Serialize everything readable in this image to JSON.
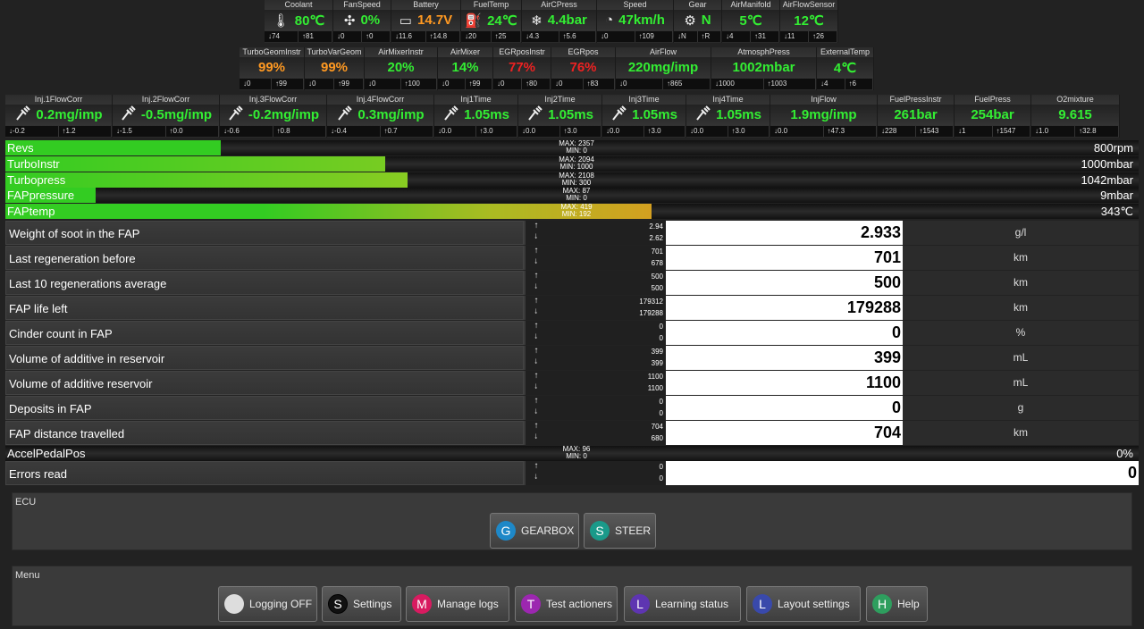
{
  "row1": [
    {
      "label": "Coolant",
      "value": "80℃",
      "color": "green",
      "icon": "🌡",
      "min": "↓74",
      "max": "↑81"
    },
    {
      "label": "FanSpeed",
      "value": "0%",
      "color": "green",
      "icon": "✣",
      "min": "↓0",
      "max": "↑0"
    },
    {
      "label": "Battery",
      "value": "14.7V",
      "color": "orange",
      "icon": "▭",
      "min": "↓11.6",
      "max": "↑14.8"
    },
    {
      "label": "FuelTemp",
      "value": "24℃",
      "color": "green",
      "icon": "⛽",
      "min": "↓20",
      "max": "↑25"
    },
    {
      "label": "AirCPress",
      "value": "4.4bar",
      "color": "green",
      "icon": "❄",
      "min": "↓4.3",
      "max": "↑5.6"
    },
    {
      "label": "Speed",
      "value": "47km/h",
      "color": "green",
      "icon": "◔",
      "min": "↓0",
      "max": "↑109"
    },
    {
      "label": "Gear",
      "value": "N",
      "color": "green",
      "icon": "⚙",
      "min": "↓N",
      "max": "↑R"
    },
    {
      "label": "AirManifold",
      "value": "5℃",
      "color": "green",
      "icon": "",
      "min": "↓4",
      "max": "↑31"
    },
    {
      "label": "AirFlowSensor",
      "value": "12℃",
      "color": "green",
      "icon": "",
      "min": "↓11",
      "max": "↑26"
    }
  ],
  "row2": [
    {
      "label": "TurboGeomInstr",
      "value": "99%",
      "color": "orange",
      "min": "↓0",
      "max": "↑99"
    },
    {
      "label": "TurboVarGeom",
      "value": "99%",
      "color": "orange",
      "min": "↓0",
      "max": "↑99"
    },
    {
      "label": "AirMixerInstr",
      "value": "20%",
      "color": "green",
      "min": "↓0",
      "max": "↑100"
    },
    {
      "label": "AirMixer",
      "value": "14%",
      "color": "green",
      "min": "↓0",
      "max": "↑99"
    },
    {
      "label": "EGRposInstr",
      "value": "77%",
      "color": "red",
      "min": "↓0",
      "max": "↑80"
    },
    {
      "label": "EGRpos",
      "value": "76%",
      "color": "red",
      "min": "↓0",
      "max": "↑83"
    },
    {
      "label": "AirFlow",
      "value": "220mg/imp",
      "color": "green",
      "min": "↓0",
      "max": "↑865"
    },
    {
      "label": "AtmosphPress",
      "value": "1002mbar",
      "color": "green",
      "min": "↓1000",
      "max": "↑1003"
    },
    {
      "label": "ExternalTemp",
      "value": "4℃",
      "color": "green",
      "min": "↓4",
      "max": "↑6"
    }
  ],
  "row3": [
    {
      "label": "Inj.1FlowCorr",
      "value": "0.2mg/imp",
      "color": "green",
      "icon": "injector",
      "min": "↓-0.2",
      "max": "↑1.2"
    },
    {
      "label": "Inj.2FlowCorr",
      "value": "-0.5mg/imp",
      "color": "green",
      "icon": "injector",
      "min": "↓-1.5",
      "max": "↑0.0"
    },
    {
      "label": "Inj.3FlowCorr",
      "value": "-0.2mg/imp",
      "color": "green",
      "icon": "injector",
      "min": "↓-0.6",
      "max": "↑0.8"
    },
    {
      "label": "Inj.4FlowCorr",
      "value": "0.3mg/imp",
      "color": "green",
      "icon": "injector",
      "min": "↓-0.4",
      "max": "↑0.7"
    },
    {
      "label": "Inj1Time",
      "value": "1.05ms",
      "color": "green",
      "icon": "injector",
      "min": "↓0.0",
      "max": "↑3.0"
    },
    {
      "label": "Inj2Time",
      "value": "1.05ms",
      "color": "green",
      "icon": "injector",
      "min": "↓0.0",
      "max": "↑3.0"
    },
    {
      "label": "Inj3Time",
      "value": "1.05ms",
      "color": "green",
      "icon": "injector",
      "min": "↓0.0",
      "max": "↑3.0"
    },
    {
      "label": "Inj4Time",
      "value": "1.05ms",
      "color": "green",
      "icon": "injector",
      "min": "↓0.0",
      "max": "↑3.0"
    },
    {
      "label": "InjFlow",
      "value": "1.9mg/imp",
      "color": "green",
      "icon": "",
      "min": "↓0.0",
      "max": "↑47.3"
    },
    {
      "label": "FuelPressInstr",
      "value": "261bar",
      "color": "green",
      "icon": "",
      "min": "↓228",
      "max": "↑1543"
    },
    {
      "label": "FuelPress",
      "value": "254bar",
      "color": "green",
      "icon": "",
      "min": "↓1",
      "max": "↑1547"
    },
    {
      "label": "O2mixture",
      "value": "9.615",
      "color": "green",
      "icon": "",
      "min": "↓1.0",
      "max": "↑32.8"
    }
  ],
  "bars": [
    {
      "name": "Revs",
      "value": "800rpm",
      "max": "MAX: 2357",
      "min": "MIN: 0",
      "level": 0.19
    },
    {
      "name": "TurboInstr",
      "value": "1000mbar",
      "max": "MAX: 2094",
      "min": "MIN: 1000",
      "level": 0.335
    },
    {
      "name": "Turbopress",
      "value": "1042mbar",
      "max": "MAX: 2108",
      "min": "MIN: 300",
      "level": 0.355
    },
    {
      "name": "FAPpressure",
      "value": "9mbar",
      "max": "MAX: 87",
      "min": "MIN: 0",
      "level": 0.08
    },
    {
      "name": "FAPtemp",
      "value": "343℃",
      "max": "MAX: 419",
      "min": "MIN: 192",
      "level": 0.57
    }
  ],
  "rows": [
    {
      "label": "Weight of soot in the FAP",
      "max": "2.94",
      "min": "2.62",
      "value": "2.933",
      "unit": "g/l"
    },
    {
      "label": "Last regeneration before",
      "max": "701",
      "min": "678",
      "value": "701",
      "unit": "km"
    },
    {
      "label": "Last 10 regenerations average",
      "max": "500",
      "min": "500",
      "value": "500",
      "unit": "km"
    },
    {
      "label": "FAP life left",
      "max": "179312",
      "min": "179288",
      "value": "179288",
      "unit": "km"
    },
    {
      "label": "Cinder count in FAP",
      "max": "0",
      "min": "0",
      "value": "0",
      "unit": "%"
    },
    {
      "label": "Volume of additive in reservoir",
      "max": "399",
      "min": "399",
      "value": "399",
      "unit": "mL"
    },
    {
      "label": "Volume of additive reservoir",
      "max": "1100",
      "min": "1100",
      "value": "1100",
      "unit": "mL"
    },
    {
      "label": "Deposits in FAP",
      "max": "0",
      "min": "0",
      "value": "0",
      "unit": "g"
    },
    {
      "label": "FAP distance travelled",
      "max": "704",
      "min": "680",
      "value": "704",
      "unit": "km"
    }
  ],
  "accel": {
    "name": "AccelPedalPos",
    "value": "0%",
    "max": "MAX: 96",
    "min": "MIN: 0",
    "level": 0
  },
  "errors": {
    "label": "Errors read",
    "max": "0",
    "min": "0",
    "value": "0"
  },
  "ecu": {
    "title": "ECU",
    "buttons": [
      {
        "letter": "G",
        "label": "GEARBOX",
        "color": "#1e88c8"
      },
      {
        "letter": "S",
        "label": "STEER",
        "color": "#1a9a8a"
      }
    ]
  },
  "menu": {
    "title": "Menu",
    "buttons": [
      {
        "letter": "",
        "label": "Logging OFF",
        "color": "#dddddd"
      },
      {
        "letter": "S",
        "label": "Settings",
        "color": "#111111"
      },
      {
        "letter": "M",
        "label": "Manage logs",
        "color": "#d81b60"
      },
      {
        "letter": "T",
        "label": "Test actioners",
        "color": "#9c27b0"
      },
      {
        "letter": "L",
        "label": "Learning status",
        "color": "#5e35b1"
      },
      {
        "letter": "L",
        "label": "Layout settings",
        "color": "#3949ab"
      },
      {
        "letter": "H",
        "label": "Help",
        "color": "#2e9e5e"
      }
    ]
  }
}
